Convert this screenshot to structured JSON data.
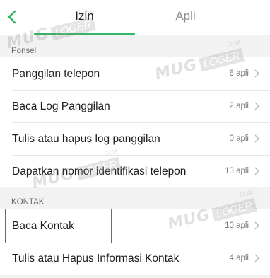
{
  "header": {
    "back_icon": "chevron-left-icon",
    "tabs": [
      {
        "label": "Izin",
        "active": true
      },
      {
        "label": "Apli",
        "active": false
      }
    ],
    "accent_color": "#33b565"
  },
  "sections": [
    {
      "label": "Ponsel",
      "items": [
        {
          "label": "Panggilan telepon",
          "count": "6 apli"
        },
        {
          "label": "Baca Log Panggilan",
          "count": "2 apli"
        },
        {
          "label": "Tulis atau hapus log panggilan",
          "count": "0 apli"
        },
        {
          "label": "Dapatkan nomor identifikasi telepon",
          "count": "13 apli"
        }
      ]
    },
    {
      "label": "KONTAK",
      "items": [
        {
          "label": "Baca Kontak",
          "count": "10 apli",
          "highlighted": true
        },
        {
          "label": "Tulis atau Hapus Informasi Kontak",
          "count": "4 apli"
        }
      ]
    }
  ],
  "watermark": {
    "text": "MUG",
    "box": "LOGER",
    "suffix": ".COM"
  }
}
